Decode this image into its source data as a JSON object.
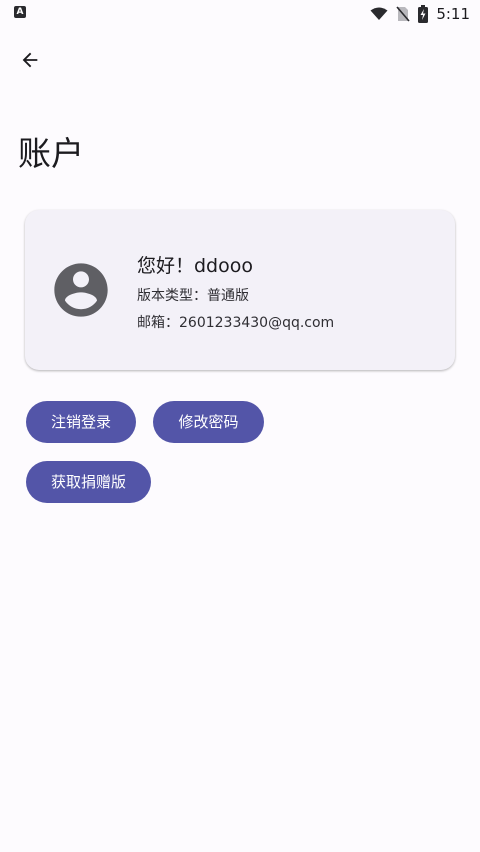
{
  "status_bar": {
    "left_icon": "A",
    "time": "5:11",
    "icons": [
      "wifi-icon",
      "no-sim-icon",
      "battery-charging-icon"
    ]
  },
  "header": {
    "back_icon": "arrow-left-icon",
    "title": "账户"
  },
  "account_card": {
    "avatar_icon": "account-circle-icon",
    "greeting": "您好！ddooo",
    "version": "版本类型：普通版",
    "email": "邮箱：2601233430@qq.com"
  },
  "actions": {
    "logout_label": "注销登录",
    "change_password_label": "修改密码",
    "get_donation_label": "获取捐赠版"
  },
  "colors": {
    "background": "#fdfbfe",
    "card": "#f3f1f8",
    "accent": "#5355a8",
    "avatar": "#5f5f64"
  }
}
